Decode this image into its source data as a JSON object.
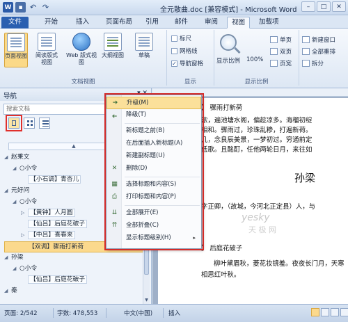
{
  "titlebar": {
    "title": "全元散曲.doc [兼容模式] - Microsoft Word",
    "qat_word": "W",
    "qat_save": "▪",
    "undo": "↶",
    "redo": "↷",
    "minimize": "–",
    "maximize": "□",
    "close": "✕"
  },
  "tabs": [
    "文件",
    "开始",
    "插入",
    "页面布局",
    "引用",
    "邮件",
    "审阅",
    "视图",
    "加载项"
  ],
  "ribbon": {
    "doc_views": {
      "label": "文档视图",
      "buttons": [
        "页面视图",
        "阅读版式视图",
        "Web 版式视图",
        "大纲视图",
        "草稿"
      ]
    },
    "show": {
      "label": "显示",
      "ruler": "标尺",
      "gridlines": "网格线",
      "nav_pane": "导航窗格",
      "checked_mark": "✓"
    },
    "zoom": {
      "label": "显示比例",
      "zoom_btn": "显示比例",
      "percent": "100%",
      "one_page": "单页",
      "two_pages": "双页",
      "page_width": "页宽"
    },
    "window": {
      "new_window": "新建窗口",
      "arrange_all": "全部重排",
      "split": "拆分"
    }
  },
  "nav": {
    "title": "导航",
    "close": "▾ ✕",
    "search_placeholder": "搜索文档",
    "search_dropdown": "▾",
    "collapse_arrow": "▲",
    "tree": [
      {
        "arrow": "◢",
        "label": "赵秉文",
        "indent": 0
      },
      {
        "arrow": "◢",
        "label": "○小令",
        "indent": 1
      },
      {
        "arrow": "",
        "label": "【小石调】青杏儿",
        "indent": 2,
        "boxed": true
      },
      {
        "arrow": "◢",
        "label": "元好问",
        "indent": 0
      },
      {
        "arrow": "◢",
        "label": "○小令",
        "indent": 1
      },
      {
        "arrow": "▷",
        "label": "【黄钟】人月圆",
        "indent": 2,
        "boxed": true
      },
      {
        "arrow": "",
        "label": "【仙吕】后庭花破子",
        "indent": 2,
        "boxed": true
      },
      {
        "arrow": "▷",
        "label": "【中吕】喜春来",
        "indent": 2,
        "boxed": true
      },
      {
        "arrow": "",
        "label": "【双调】骤雨打新荷",
        "indent": 2,
        "selected": true
      },
      {
        "arrow": "◢",
        "label": "孙梁",
        "indent": 0
      },
      {
        "arrow": "◢",
        "label": "○小令",
        "indent": 1
      },
      {
        "arrow": "",
        "label": "【仙吕】后庭花破子",
        "indent": 2,
        "boxed": true
      },
      {
        "arrow": "◢",
        "label": "秦",
        "indent": 0
      }
    ]
  },
  "context_menu": {
    "items": [
      {
        "icon": "➔",
        "label": "升级(M)",
        "highlight": true
      },
      {
        "icon": "➔",
        "label": "降级(T)"
      },
      {
        "sep": true
      },
      {
        "icon": "",
        "label": "新标题之前(B)"
      },
      {
        "icon": "",
        "label": "在后面插入新标题(A)"
      },
      {
        "icon": "",
        "label": "新建副标题(U)"
      },
      {
        "icon": "✕",
        "label": "删除(D)"
      },
      {
        "sep": true
      },
      {
        "icon": "▦",
        "label": "选择标题和内容(S)"
      },
      {
        "icon": "⎙",
        "label": "打印标题和内容(P)"
      },
      {
        "sep": true
      },
      {
        "icon": "⇊",
        "label": "全部展开(E)"
      },
      {
        "icon": "⇈",
        "label": "全部折叠(C)"
      },
      {
        "icon": "",
        "label": "显示标题级别(H)",
        "submenu": "▸"
      }
    ]
  },
  "document": {
    "lines": [
      "】 骤雨打新荷",
      "浓，遍池塘水阁，偏趁凉多。海榴初绽",
      "相和。骤雨过，珍珠乱糁，打遍新荷。",
      "几，念良辰美景，一梦初过。穷通前定",
      "低歌。且酩酊，任他两轮日月，来往如",
      "孙梁",
      "字正卿，（故城，今河北正定县）人，与",
      "】 后庭花破子",
      "柳叶黛眉秋，菱花妆镜羞。夜夜长门月，天寒",
      "相思红叶秋。"
    ],
    "watermark_site": "yesky",
    "watermark_cn": "天 极 网"
  },
  "status": {
    "page": "页面: 2/542",
    "words": "字数: 478,553",
    "lang": "中文(中国)",
    "mode": "插入"
  }
}
